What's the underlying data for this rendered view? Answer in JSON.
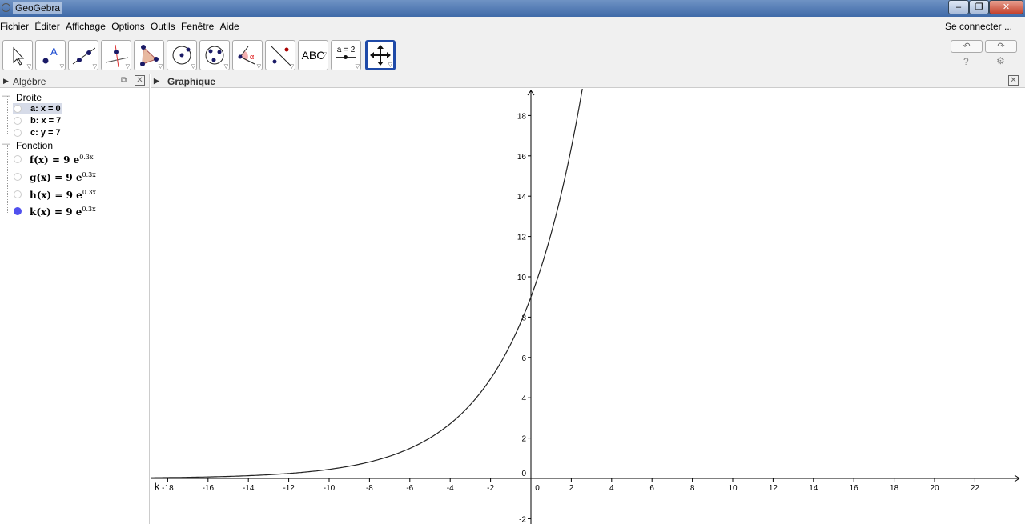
{
  "window": {
    "title": "GeoGebra",
    "min": "–",
    "max": "❐",
    "close": "✕"
  },
  "menu": {
    "items": [
      "Fichier",
      "Éditer",
      "Affichage",
      "Options",
      "Outils",
      "Fenêtre",
      "Aide"
    ],
    "connect": "Se connecter ..."
  },
  "toolbar": {
    "tools": [
      "move",
      "point",
      "line",
      "perpendicular",
      "polygon",
      "circle-center",
      "circle-3pts",
      "angle",
      "reflect",
      "text",
      "slider",
      "move-graphics"
    ],
    "text_label": "ABC",
    "slider_label": "a = 2",
    "undo": "↶",
    "redo": "↷",
    "help": "?",
    "settings": "⚙"
  },
  "algebra": {
    "title": "Algèbre",
    "groups": [
      {
        "name": "Droite",
        "items": [
          {
            "label": "a: x = 0",
            "selected": true
          },
          {
            "label": "b: x = 7"
          },
          {
            "label": "c: y = 7"
          }
        ]
      },
      {
        "name": "Fonction",
        "items": [
          {
            "name": "f(x)",
            "eq": "= 9 e",
            "exp": "0.3x"
          },
          {
            "name": "g(x)",
            "eq": "= 9 e",
            "exp": "0.3x"
          },
          {
            "name": "h(x)",
            "eq": "= 9 e",
            "exp": "0.3x"
          },
          {
            "name": "k(x)",
            "eq": "= 9 e",
            "exp": "0.3x",
            "visible": true
          }
        ]
      }
    ]
  },
  "graphics": {
    "title": "Graphique",
    "curve_label": "k",
    "function": {
      "a": 9,
      "b": 0.3
    },
    "x_ticks": [
      -18,
      -16,
      -14,
      -12,
      -10,
      -8,
      -6,
      -4,
      -2,
      0,
      2,
      4,
      6,
      8,
      10,
      12,
      14,
      16,
      18,
      20,
      22
    ],
    "y_ticks": [
      -2,
      0,
      2,
      4,
      6,
      8,
      10,
      12,
      14,
      16,
      18
    ],
    "visible_color": "#5050ee"
  }
}
